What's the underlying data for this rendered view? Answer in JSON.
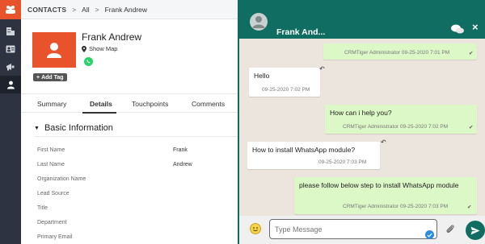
{
  "breadcrumb": {
    "module": "CONTACTS",
    "sep1": ">",
    "filter": "All",
    "sep2": ">",
    "record": "Frank Andrew"
  },
  "record": {
    "name": "Frank Andrew",
    "show_map": "Show Map",
    "add_tag": "Add Tag",
    "tabs": [
      "Summary",
      "Details",
      "Touchpoints",
      "Comments"
    ],
    "active_tab": "Details",
    "section_title": "Basic Information",
    "fields": [
      {
        "label": "First Name",
        "value": "Frank"
      },
      {
        "label": "Last Name",
        "value": "Andrew"
      },
      {
        "label": "Organization Name",
        "value": ""
      },
      {
        "label": "Lead Source",
        "value": ""
      },
      {
        "label": "Title",
        "value": ""
      },
      {
        "label": "Department",
        "value": ""
      },
      {
        "label": "Primary Email",
        "value": ""
      }
    ]
  },
  "chat": {
    "title": "Frank And...",
    "messages": [
      {
        "dir": "out",
        "text": "",
        "meta": "CRMTiger Administrator 09-25-2020 7:01 PM"
      },
      {
        "dir": "in",
        "text": "Hello",
        "meta": "09-25-2020 7:02 PM"
      },
      {
        "dir": "out",
        "text": "How can i help you?",
        "meta": "CRMTiger Administrator 09-25-2020 7:02 PM"
      },
      {
        "dir": "in",
        "text": "How to install WhatsApp module?",
        "meta": "09-25-2020 7:03 PM"
      },
      {
        "dir": "out",
        "text": "please follow below step to install WhatsApp module",
        "meta": "CRMTiger Administrator 09-25-2020 7:03 PM"
      }
    ],
    "composer_placeholder": "Type Message"
  },
  "colors": {
    "brand": "#e9532c",
    "chat_header": "#0f6e61",
    "outgoing": "#dcf8c6",
    "chat_bg": "#ece5dd"
  }
}
